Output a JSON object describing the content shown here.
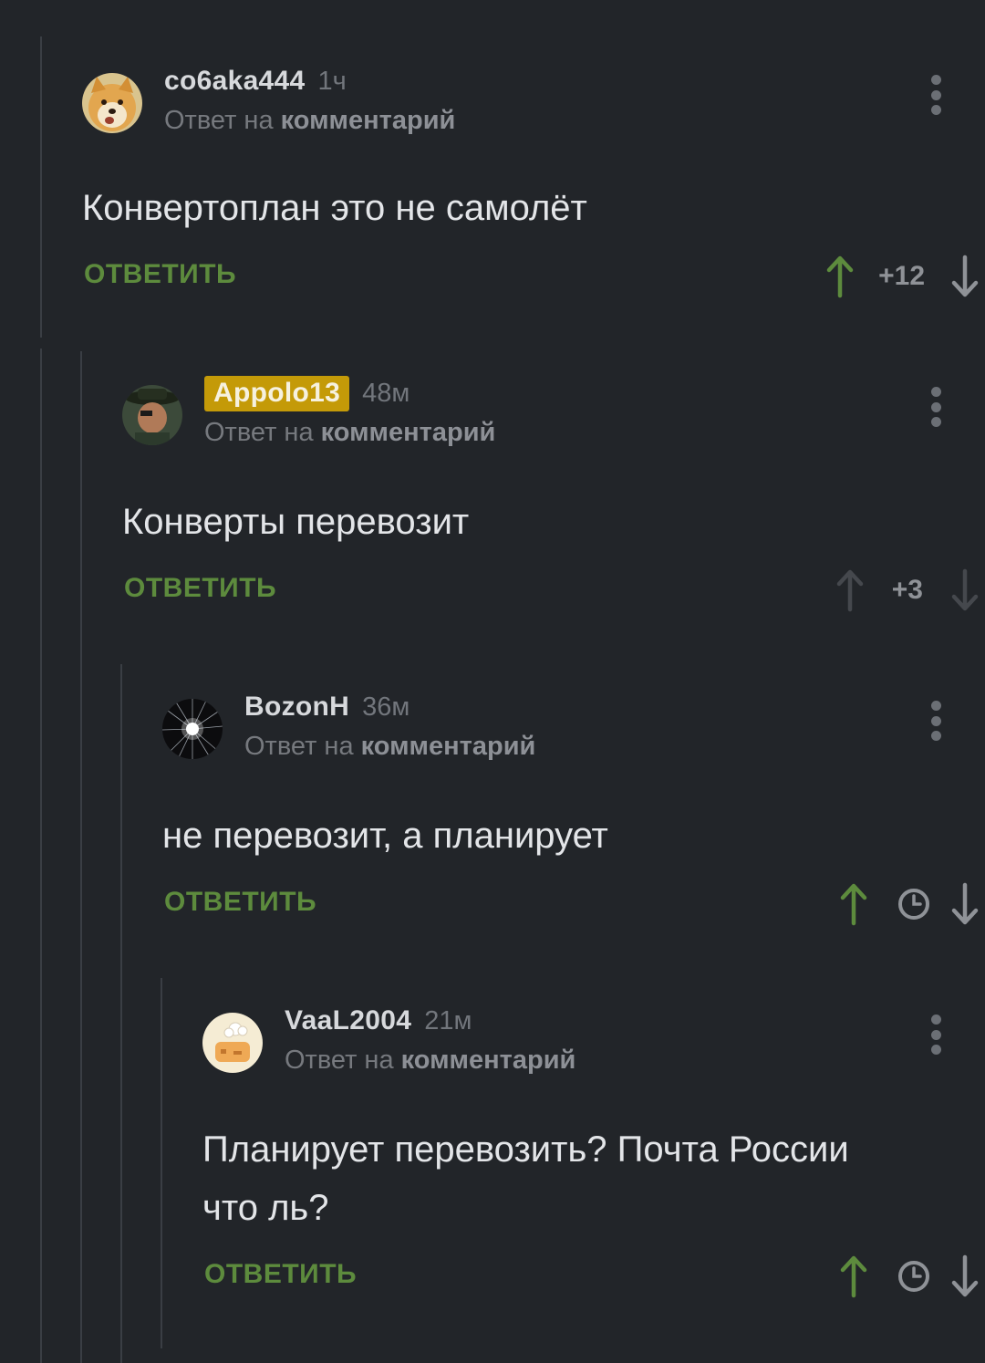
{
  "reply_label": "ОТВЕТИТЬ",
  "reply_prefix": "Ответ на",
  "reply_target": "комментарий",
  "colors": {
    "background": "#222529",
    "accent_green": "#5d8b3d",
    "badge_gold": "#c49a08"
  },
  "comments": [
    {
      "username": "co6aka444",
      "time": "1ч",
      "text": "Конвертоплан это не самолёт",
      "score": "+12",
      "upvoted": true,
      "avatar": "doge-avatar"
    },
    {
      "username": "Appolo13",
      "time": "48м",
      "text": "Конверты перевозит",
      "score": "+3",
      "upvoted": false,
      "badge": true,
      "avatar": "hat-man-avatar"
    },
    {
      "username": "BozonH",
      "time": "36м",
      "text": "не перевозит, а планирует",
      "score_hidden": true,
      "upvoted": true,
      "avatar": "starburst-avatar"
    },
    {
      "username": "VaaL2004",
      "time": "21м",
      "text_line1": "Планирует перевозить? Почта России",
      "text_line2": "что ль?",
      "score_hidden": true,
      "upvoted": true,
      "avatar": "cartoon-avatar"
    }
  ]
}
